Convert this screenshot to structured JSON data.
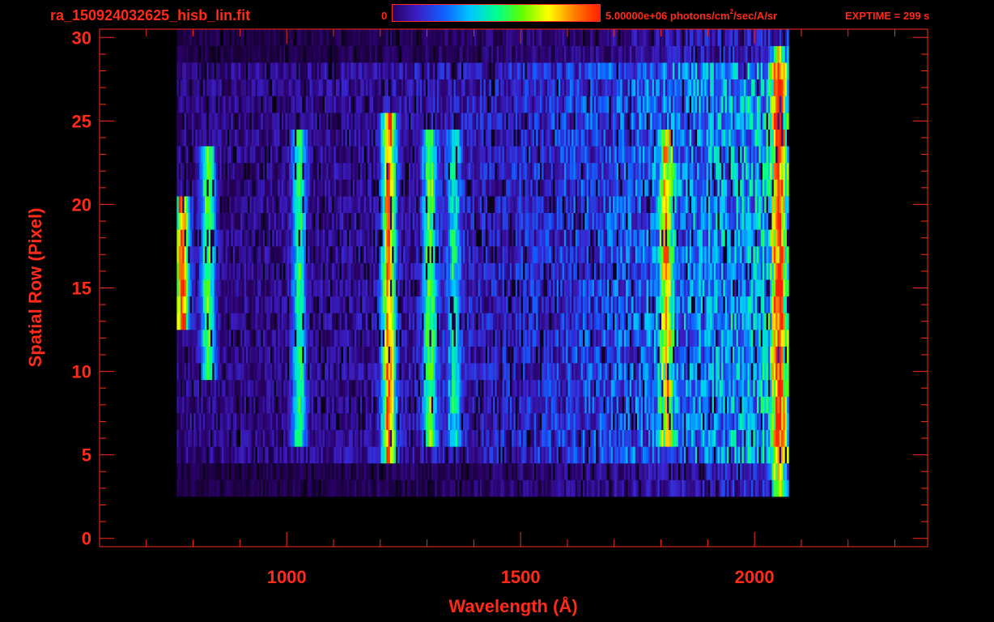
{
  "header": {
    "file_title": "ra_150924032625_hisb_lin.fit",
    "colorbar_min": "0",
    "colorbar_max_prefix": "5.00000e+06 photons/cm",
    "colorbar_max_sup": "2",
    "colorbar_max_suffix": "/sec/A/sr",
    "exptime": "EXPTIME = 299 s"
  },
  "colors": {
    "axis": "#ff2a1a",
    "background": "#000000",
    "colormap": [
      "#000000",
      "#2a0066",
      "#3a20c8",
      "#1060ff",
      "#00c8ff",
      "#00ff90",
      "#60ff00",
      "#ffff00",
      "#ff8000",
      "#ff2000"
    ]
  },
  "chart_data": {
    "type": "heatmap",
    "xlabel": "Wavelength (Å)",
    "ylabel": "Spatial Row (Pixel)",
    "xlim": [
      600,
      2370
    ],
    "ylim": [
      -0.5,
      30.5
    ],
    "x_ticks": [
      1000,
      1500,
      2000
    ],
    "y_ticks": [
      0,
      5,
      10,
      15,
      20,
      25,
      30
    ],
    "colorbar_range": [
      0,
      5000000
    ],
    "data_x_range": [
      765,
      2070
    ],
    "data_rows": [
      3,
      30
    ],
    "emission_features": [
      {
        "wavelength": 775,
        "rows": [
          13,
          20
        ],
        "intensity": 0.9
      },
      {
        "wavelength": 830,
        "rows": [
          10,
          23
        ],
        "intensity": 0.55
      },
      {
        "wavelength": 1025,
        "rows": [
          6,
          24
        ],
        "intensity": 0.45
      },
      {
        "wavelength": 1216,
        "rows": [
          5,
          25
        ],
        "intensity": 0.82
      },
      {
        "wavelength": 1304,
        "rows": [
          6,
          24
        ],
        "intensity": 0.5
      },
      {
        "wavelength": 1356,
        "rows": [
          6,
          24
        ],
        "intensity": 0.35
      },
      {
        "wavelength": 1810,
        "rows": [
          6,
          24
        ],
        "intensity": 0.55
      },
      {
        "wavelength": 2050,
        "rows": [
          3,
          29
        ],
        "intensity": 0.65
      }
    ]
  }
}
